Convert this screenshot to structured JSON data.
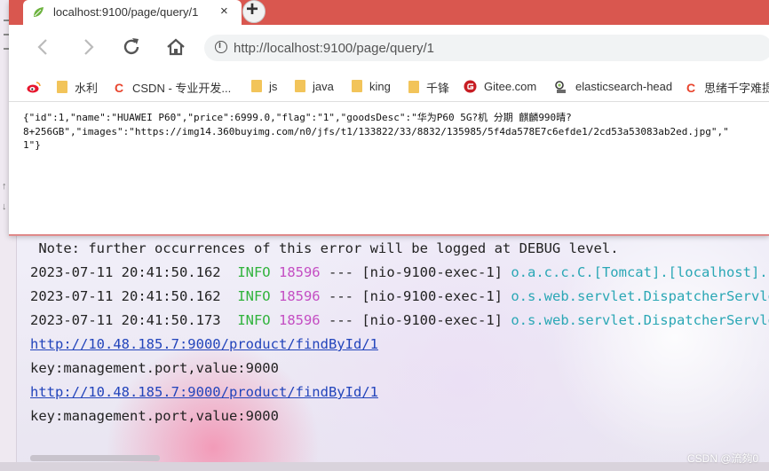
{
  "browser": {
    "tab_title": "localhost:9100/page/query/1",
    "tab_close": "×",
    "new_tab": "+",
    "url": "http://localhost:9100/page/query/1",
    "accent_color": "#d9574f",
    "bookmarks": [
      {
        "icon": "weibo-icon",
        "label": ""
      },
      {
        "icon": "folder-icon",
        "label": "水利"
      },
      {
        "icon": "csdn-icon",
        "label": "CSDN - 专业开发..."
      },
      {
        "icon": "folder-icon",
        "label": "js"
      },
      {
        "icon": "folder-icon",
        "label": "java"
      },
      {
        "icon": "folder-icon",
        "label": "king"
      },
      {
        "icon": "folder-icon",
        "label": "千锋"
      },
      {
        "icon": "gitee-icon",
        "label": "Gitee.com"
      },
      {
        "icon": "elasticsearch-icon",
        "label": "elasticsearch-head"
      },
      {
        "icon": "csdn-icon",
        "label": "思绪千字难提"
      }
    ],
    "json_lines": [
      "{\"id\":1,\"name\":\"HUAWEI P60\",\"price\":6999.0,\"flag\":\"1\",\"goodsDesc\":\"华为P60 5G?机 分期 麒麟990晴?",
      "8+256GB\",\"images\":\"https://img14.360buyimg.com/n0/jfs/t1/133822/33/8832/135985/5f4da578E7c6efde1/2cd53a53083ab2ed.jpg\",\"",
      "1\"}"
    ]
  },
  "console": {
    "note": " Note: further occurrences of this error will be logged at DEBUG level.",
    "logs": [
      {
        "time": "2023-07-11 20:41:50.162",
        "level": "INFO",
        "pid": "18596",
        "sep": "---",
        "thread": "[nio-9100-exec-1]",
        "logger": "o.a.c.c.C.[Tomcat].[localhost].[/]"
      },
      {
        "time": "2023-07-11 20:41:50.162",
        "level": "INFO",
        "pid": "18596",
        "sep": "---",
        "thread": "[nio-9100-exec-1]",
        "logger": "o.s.web.servlet.DispatcherServlet"
      },
      {
        "time": "2023-07-11 20:41:50.173",
        "level": "INFO",
        "pid": "18596",
        "sep": "---",
        "thread": "[nio-9100-exec-1]",
        "logger": "o.s.web.servlet.DispatcherServlet"
      }
    ],
    "link1": "http://10.48.185.7:9000/product/findById/1",
    "kv1": "key:management.port,value:9000",
    "link2": "http://10.48.185.7:9000/product/findById/1",
    "kv2": "key:management.port,value:9000",
    "colors": {
      "info": "#31b33d",
      "pid": "#c44ec3",
      "logger": "#2aa7b5",
      "link": "#2244bb"
    }
  },
  "watermark": "CSDN @流夠0"
}
